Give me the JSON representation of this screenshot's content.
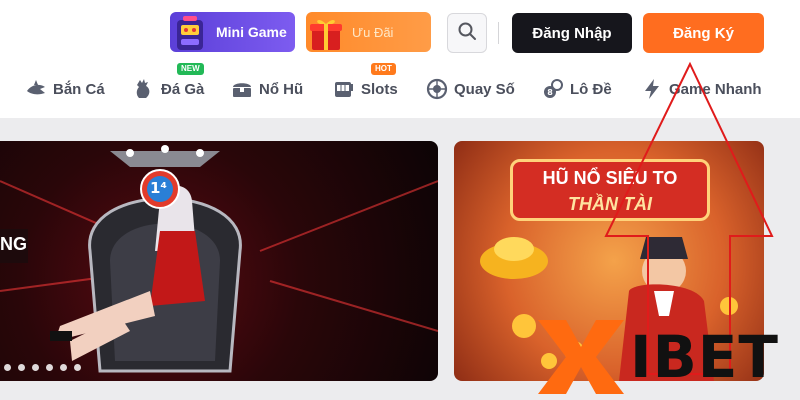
{
  "header": {
    "promos": [
      {
        "label": "Mini Game",
        "icon": "slot-machine-icon"
      },
      {
        "label": "Ưu Đãi",
        "icon": "gift-box-icon"
      }
    ],
    "search_icon": "search-icon",
    "login_label": "Đăng Nhập",
    "register_label": "Đăng Ký"
  },
  "nav": {
    "items": [
      {
        "label": "Bắn Cá",
        "icon": "shark-icon"
      },
      {
        "label": "Đá Gà",
        "icon": "rooster-icon",
        "badge": "NEW"
      },
      {
        "label": "Nổ Hũ",
        "icon": "treasure-chest-icon"
      },
      {
        "label": "Slots",
        "icon": "slot-machine-icon",
        "badge": "HOT"
      },
      {
        "label": "Quay Số",
        "icon": "lottery-wheel-icon"
      },
      {
        "label": "Lô Đề",
        "icon": "lottery-balls-icon"
      },
      {
        "label": "Game Nhanh",
        "icon": "lightning-icon"
      }
    ]
  },
  "banners": {
    "main": {
      "badge_text": "1⁴",
      "side_text": "NG",
      "slide_count": 6
    },
    "side": {
      "title_line1": "HŨ NỔ SIÊU TO",
      "title_line2": "THẦN TÀI"
    }
  },
  "watermark": {
    "text": "IBET"
  },
  "colors": {
    "accent_orange": "#ff6d1f",
    "dark_button": "#16161c",
    "mini_game_purple": "#6a4ce6",
    "annotation_red": "#e01b1b"
  }
}
